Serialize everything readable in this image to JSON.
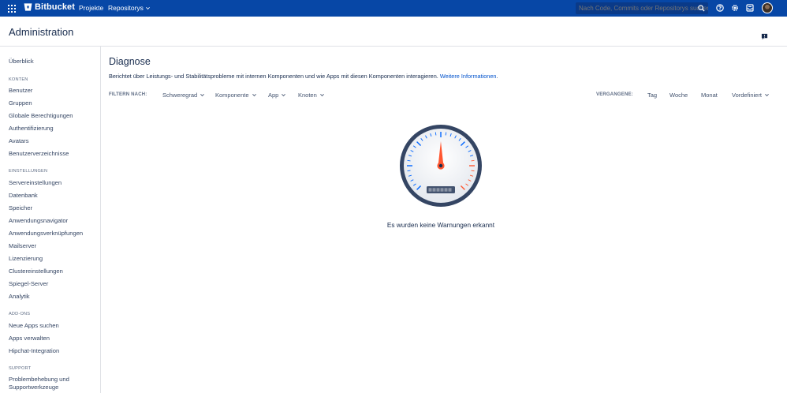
{
  "topbar": {
    "brand": "Bitbucket",
    "projects": "Projekte",
    "repositories": "Repositorys",
    "search_placeholder": "Nach Code, Commits oder Repositorys suchen",
    "icons": [
      "apps-icon",
      "search-icon",
      "help-icon",
      "gear-icon",
      "inbox-icon",
      "avatar"
    ],
    "bg_color": "#0747a6"
  },
  "header": {
    "title": "Administration"
  },
  "sidebar": {
    "overview": "Überblick",
    "sections": [
      {
        "heading": "KONTEN",
        "items": [
          "Benutzer",
          "Gruppen",
          "Globale Berechtigungen",
          "Authentifizierung",
          "Avatars",
          "Benutzerverzeichnisse"
        ]
      },
      {
        "heading": "EINSTELLUNGEN",
        "items": [
          "Servereinstellungen",
          "Datenbank",
          "Speicher",
          "Anwendungsnavigator",
          "Anwendungsverknüpfungen",
          "Mailserver",
          "Lizenzierung",
          "Clustereinstellungen",
          "Spiegel-Server",
          "Analytik"
        ]
      },
      {
        "heading": "ADD-ONS",
        "items": [
          "Neue Apps suchen",
          "Apps verwalten",
          "Hipchat-Integration"
        ]
      },
      {
        "heading": "SUPPORT",
        "items": [
          "Problembehebung und Supportwerkzeuge"
        ]
      }
    ]
  },
  "main": {
    "title": "Diagnose",
    "description": "Berichtet über Leistungs- und Stabilitätsprobleme mit internen Komponenten und wie Apps mit diesen Komponenten interagieren.",
    "more_link": "Weitere Informationen",
    "period_suffix": ".",
    "filter_label": "FILTERN NACH:",
    "filters": [
      "Schweregrad",
      "Komponente",
      "App",
      "Knoten"
    ],
    "period_label": "VERGANGENE:",
    "periods": [
      "Tag",
      "Woche",
      "Monat"
    ],
    "custom_period": "Vordefiniert",
    "empty_message": "Es wurden keine Warnungen erkannt",
    "link_color": "#0052cc"
  }
}
